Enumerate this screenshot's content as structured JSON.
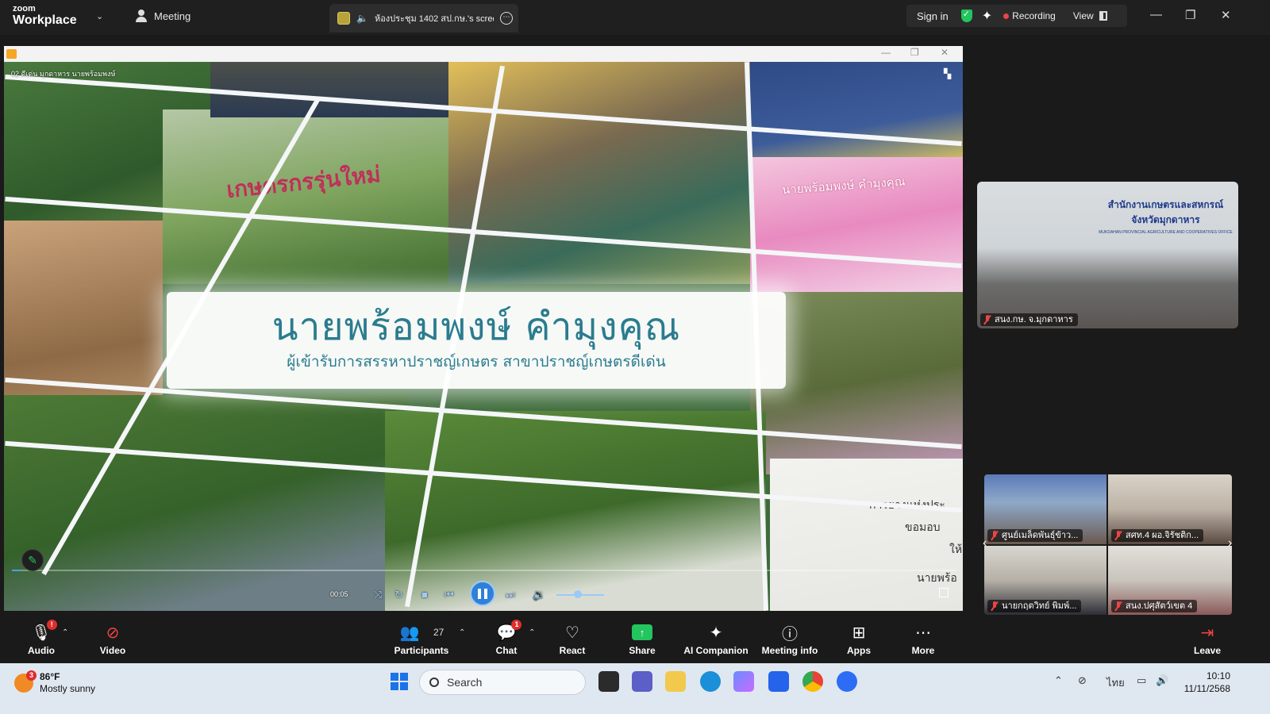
{
  "topbar": {
    "logo_top": "zoom",
    "logo_bottom": "Workplace",
    "meeting_label": "Meeting",
    "share_title": "ห้องประชุม 1402 สป.กษ.'s screen",
    "sign_in": "Sign in",
    "recording": "Recording",
    "view": "View"
  },
  "share": {
    "video_label": "02 ดีเด่น มุกดาหาร นายพร้อมพงษ์",
    "banner_name": "นายพร้อมพงษ์  คำมุงคุณ",
    "banner_sub": "ผู้เข้ารับการสรรหาปราชญ์เกษตร สาขาปราชญ์เกษตรดีเด่น",
    "sign_text_1": "นายพร้อมพงษ์ คำมุงคุณ",
    "sign_text_2": "เกษตรกรรุ่นใหม่",
    "right_text_1": "การยางแห่งประ",
    "right_text_2": "ขอมอบ",
    "right_text_3": "ให้",
    "right_text_4": "นายพร้อ",
    "time": "00:05",
    "progress_fraction": 0.01
  },
  "participants_panel": {
    "main_tile": {
      "label": "สนง.กษ. จ.มุกดาหาร",
      "sign_line1": "สำนักงานเกษตรและสหกรณ์",
      "sign_line2": "จังหวัดมุกดาหาร",
      "sign_line3": "MUKDAHAN PROVINCIAL AGRICULTURE AND COOPERATIVES OFFICE"
    },
    "tiles": [
      {
        "label": "ศูนย์เมล็ดพันธุ์ข้าว...",
        "bg": "#7b8fb0"
      },
      {
        "label": "สศท.4 ผอ.จิรัชติก...",
        "bg": "#9a8f88"
      },
      {
        "label": "นายกฤตวิทย์ พิมพ์...",
        "bg": "#7e776f"
      },
      {
        "label": "สนง.ปศุสัตว์เขต 4",
        "bg": "#a5a096"
      }
    ]
  },
  "toolbar": {
    "audio": "Audio",
    "audio_badge": "!",
    "video": "Video",
    "participants": "Participants",
    "participants_count": "27",
    "chat": "Chat",
    "chat_badge": "1",
    "react": "React",
    "share": "Share",
    "ai_companion": "AI Companion",
    "meeting_info": "Meeting info",
    "apps": "Apps",
    "more": "More",
    "leave": "Leave"
  },
  "taskbar": {
    "weather_badge": "3",
    "temp": "86°F",
    "condition": "Mostly sunny",
    "search": "Search",
    "lang": "ไทย",
    "time": "10:10",
    "date": "11/11/2568"
  },
  "colors": {
    "accent_blue": "#2f80d8",
    "recording_red": "#ef4444",
    "share_green": "#22c55e",
    "banner_teal": "#2a7c8e"
  }
}
